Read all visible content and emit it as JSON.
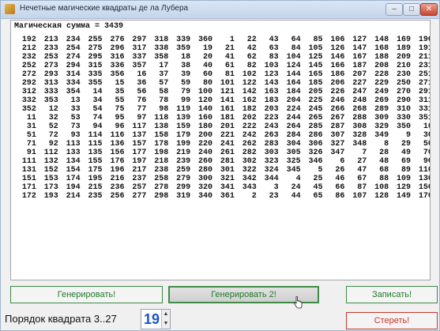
{
  "window": {
    "title": "Нечетные магические квадраты де ла Лубера",
    "minimize_icon": "–",
    "maximize_icon": "□",
    "close_icon": "✕"
  },
  "output": {
    "sum_line": "Магическая сумма = 3439",
    "rows": [
      [
        192,
        213,
        234,
        255,
        276,
        297,
        318,
        339,
        360,
        1,
        22,
        43,
        64,
        85,
        106,
        127,
        148,
        169,
        190
      ],
      [
        212,
        233,
        254,
        275,
        296,
        317,
        338,
        359,
        19,
        21,
        42,
        63,
        84,
        105,
        126,
        147,
        168,
        189,
        191
      ],
      [
        232,
        253,
        274,
        295,
        316,
        337,
        358,
        18,
        20,
        41,
        62,
        83,
        104,
        125,
        146,
        167,
        188,
        209,
        211
      ],
      [
        252,
        273,
        294,
        315,
        336,
        357,
        17,
        38,
        40,
        61,
        82,
        103,
        124,
        145,
        166,
        187,
        208,
        210,
        231
      ],
      [
        272,
        293,
        314,
        335,
        356,
        16,
        37,
        39,
        60,
        81,
        102,
        123,
        144,
        165,
        186,
        207,
        228,
        230,
        251
      ],
      [
        292,
        313,
        334,
        355,
        15,
        36,
        57,
        59,
        80,
        101,
        122,
        143,
        164,
        185,
        206,
        227,
        229,
        250,
        271
      ],
      [
        312,
        333,
        354,
        14,
        35,
        56,
        58,
        79,
        100,
        121,
        142,
        163,
        184,
        205,
        226,
        247,
        249,
        270,
        291
      ],
      [
        332,
        353,
        13,
        34,
        55,
        76,
        78,
        99,
        120,
        141,
        162,
        183,
        204,
        225,
        246,
        248,
        269,
        290,
        311
      ],
      [
        352,
        12,
        33,
        54,
        75,
        77,
        98,
        119,
        140,
        161,
        182,
        203,
        224,
        245,
        266,
        268,
        289,
        310,
        331
      ],
      [
        11,
        32,
        53,
        74,
        95,
        97,
        118,
        139,
        160,
        181,
        202,
        223,
        244,
        265,
        267,
        288,
        309,
        330,
        351
      ],
      [
        31,
        52,
        73,
        94,
        96,
        117,
        138,
        159,
        180,
        201,
        222,
        243,
        264,
        285,
        287,
        308,
        329,
        350,
        10
      ],
      [
        51,
        72,
        93,
        114,
        116,
        137,
        158,
        179,
        200,
        221,
        242,
        263,
        284,
        286,
        307,
        328,
        349,
        9,
        30
      ],
      [
        71,
        92,
        113,
        115,
        136,
        157,
        178,
        199,
        220,
        241,
        262,
        283,
        304,
        306,
        327,
        348,
        8,
        29,
        50
      ],
      [
        91,
        112,
        133,
        135,
        156,
        177,
        198,
        219,
        240,
        261,
        282,
        303,
        305,
        326,
        347,
        7,
        28,
        49,
        70
      ],
      [
        111,
        132,
        134,
        155,
        176,
        197,
        218,
        239,
        260,
        281,
        302,
        323,
        325,
        346,
        6,
        27,
        48,
        69,
        90
      ],
      [
        131,
        152,
        154,
        175,
        196,
        217,
        238,
        259,
        280,
        301,
        322,
        324,
        345,
        5,
        26,
        47,
        68,
        89,
        110
      ],
      [
        151,
        153,
        174,
        195,
        216,
        237,
        258,
        279,
        300,
        321,
        342,
        344,
        4,
        25,
        46,
        67,
        88,
        109,
        130
      ],
      [
        171,
        173,
        194,
        215,
        236,
        257,
        278,
        299,
        320,
        341,
        343,
        3,
        24,
        45,
        66,
        87,
        108,
        129,
        150
      ],
      [
        172,
        193,
        214,
        235,
        256,
        277,
        298,
        319,
        340,
        361,
        2,
        23,
        44,
        65,
        86,
        107,
        128,
        149,
        170
      ]
    ]
  },
  "buttons": {
    "generate": "Генерировать!",
    "generate2": "Генерировать 2!",
    "save": "Записать!",
    "clear": "Стереть!"
  },
  "order": {
    "label": "Порядок квадрата 3..27",
    "value": "19"
  },
  "colors": {
    "accent_green": "#3e8c46",
    "accent_red": "#c9362b",
    "spin_value": "#1a55c9"
  }
}
